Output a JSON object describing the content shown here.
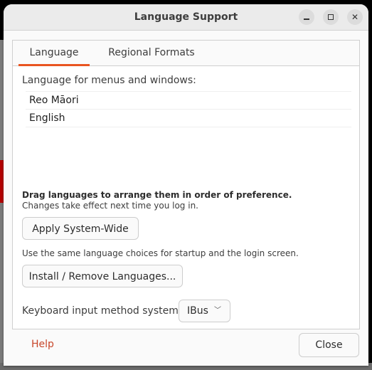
{
  "window": {
    "title": "Language Support",
    "controls": {
      "minimize": "minimize-icon",
      "maximize": "maximize-icon",
      "close": "close-icon"
    }
  },
  "tabs": [
    {
      "label": "Language",
      "active": true
    },
    {
      "label": "Regional Formats",
      "active": false
    }
  ],
  "language_tab": {
    "list_label": "Language for menus and windows:",
    "languages": [
      "Reo Māori",
      "English"
    ],
    "drag_hint": "Drag languages to arrange them in order of preference.",
    "effect_hint": "Changes take effect next time you log in.",
    "apply_button": "Apply System-Wide",
    "apply_hint": "Use the same language choices for startup and the login screen.",
    "install_button": "Install / Remove Languages...",
    "keyboard_label": "Keyboard input method system:",
    "keyboard_value": "IBus"
  },
  "footer": {
    "help": "Help",
    "close": "Close"
  },
  "colors": {
    "accent": "#e95420",
    "help_link": "#c7462a"
  }
}
